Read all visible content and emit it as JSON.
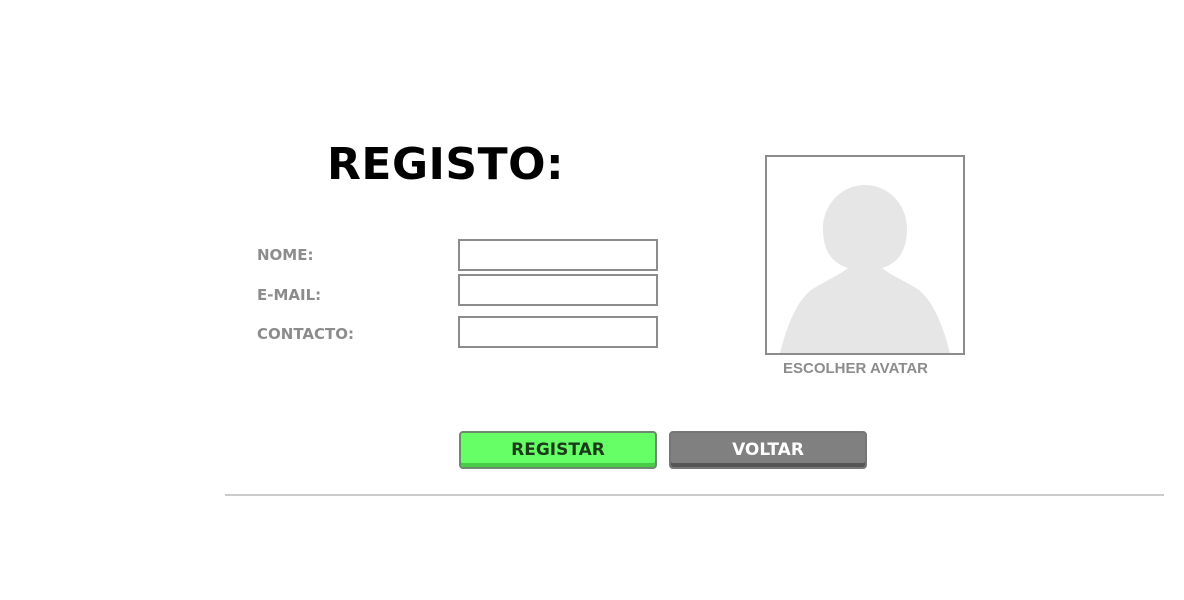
{
  "form": {
    "title": "REGISTO:",
    "fields": [
      {
        "label": "NOME:",
        "value": "",
        "placeholder": ""
      },
      {
        "label": "E-MAIL:",
        "value": "",
        "placeholder": ""
      },
      {
        "label": "CONTACTO:",
        "value": "",
        "placeholder": ""
      }
    ]
  },
  "avatar": {
    "caption": "ESCOLHER AVATAR",
    "icon": "user-silhouette-icon"
  },
  "actions": {
    "register_label": "REGISTAR",
    "back_label": "VOLTAR"
  },
  "colors": {
    "register_button": "#66ff66",
    "back_button": "#808080",
    "label_text": "#8c8c8c",
    "avatar_placeholder": "#e6e6e6"
  }
}
